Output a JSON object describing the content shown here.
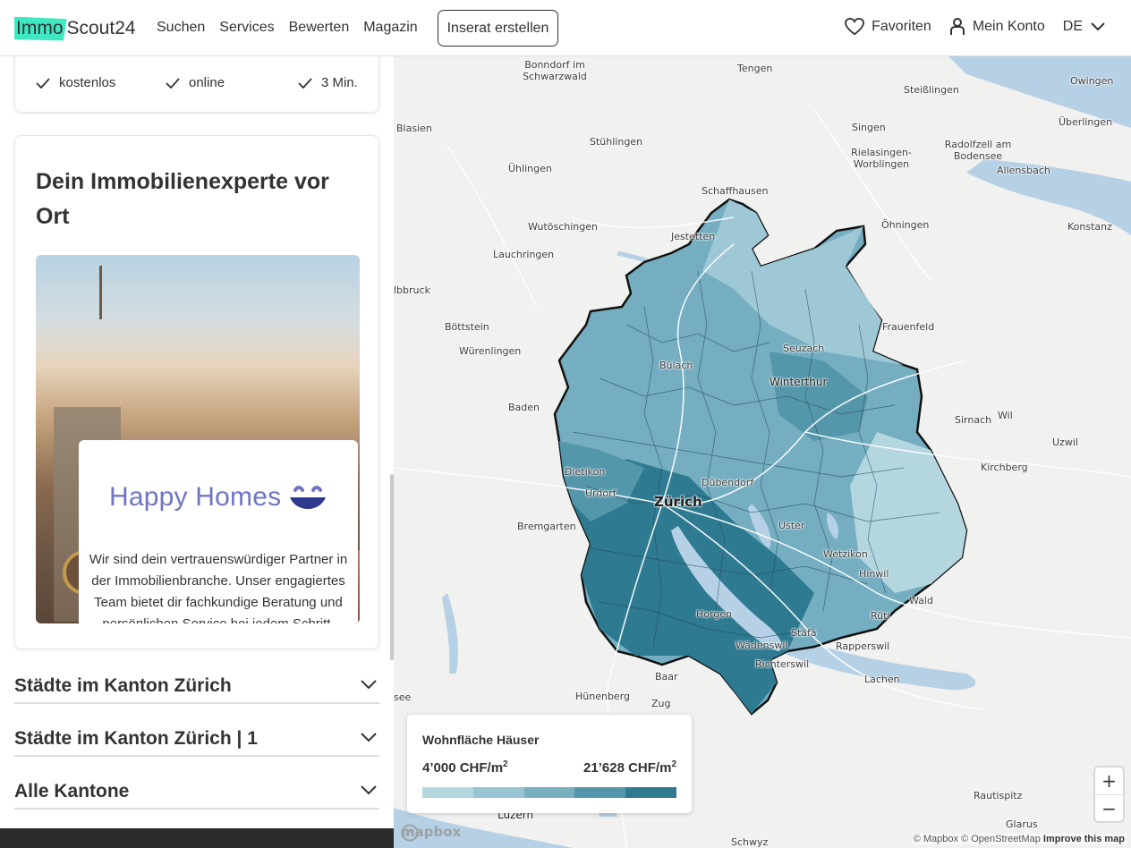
{
  "header": {
    "logo_part1": "Immo",
    "logo_part2": "Scout24",
    "nav": [
      "Suchen",
      "Services",
      "Bewerten",
      "Magazin"
    ],
    "cta": "Inserat erstellen",
    "favorites": "Favoriten",
    "account": "Mein Konto",
    "language": "DE"
  },
  "sidebar": {
    "features": [
      "kostenlos",
      "online",
      "3 Min."
    ],
    "expert_title": "Dein Immobilienexperte vor Ort",
    "agency": {
      "name": "Happy Homes",
      "description": "Wir sind dein vertrauenswürdiger Partner in der Immobilienbranche. Unser engagiertes Team bietet dir fachkundige Beratung und persönlichen Service bei jedem Schritt."
    },
    "accordions": [
      "Städte im Kanton Zürich",
      "Städte im Kanton Zürich | 1",
      "Alle Kantone"
    ]
  },
  "map": {
    "labels": {
      "major": [
        "Zürich"
      ],
      "towns": [
        "Winterthur",
        "Dübendorf",
        "Uster",
        "Wetzikon",
        "Bülach",
        "Seuzach",
        "Dietikon",
        "Urdorf",
        "Horgen",
        "Wädenswil",
        "Richterswil",
        "Stäfa",
        "Rüti",
        "Hinwil",
        "Wald",
        "Rapperswil",
        "Frauenfeld",
        "Schaffhausen",
        "Jestetten",
        "Baden",
        "Bremgarten",
        "Hünenberg",
        "Zug",
        "Baar",
        "Luzern",
        "Lachen",
        "Wil",
        "Sirnach",
        "Uzwil",
        "Kirchberg",
        "Konstanz",
        "Singen",
        "Tengen",
        "Stühlingen",
        "Ühlingen",
        "Wutöschingen",
        "Lauchringen",
        "Böttstein",
        "Würenlingen",
        "Bonndorf im Schwarzwald",
        "Radolfzell am Bodensee",
        "Allensbach",
        "Rielasingen-Worblingen",
        "Öhningen",
        "Steißlingen",
        "Owingen",
        "Überlingen",
        "Blasien",
        "lbbruck",
        "Rautispitz",
        "Glarus",
        "Schwyz",
        "see"
      ]
    },
    "legend": {
      "title": "Wohnfläche Häuser",
      "min_label": "4’000 CHF/m",
      "max_label": "21’628 CHF/m",
      "unit_exp": "2",
      "colors": [
        "#b4d6df",
        "#98c5d1",
        "#78b0c0",
        "#5597aa",
        "#2e7a91"
      ]
    },
    "zoom_in": "+",
    "zoom_out": "−",
    "brand": "mapbox",
    "attribution": {
      "mapbox": "© Mapbox",
      "osm": "© OpenStreetMap",
      "improve": "Improve this map"
    }
  }
}
